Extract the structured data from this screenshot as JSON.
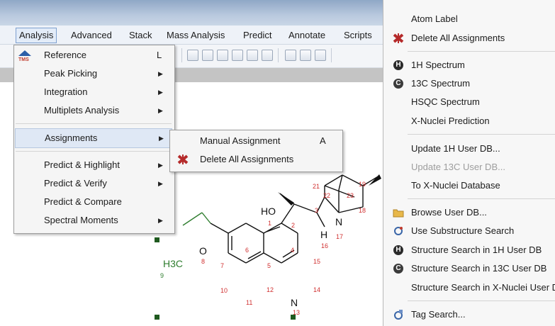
{
  "menubar": {
    "items": [
      "Analysis",
      "Advanced",
      "Stack",
      "Mass Analysis",
      "Predict",
      "Annotate",
      "Scripts"
    ]
  },
  "analysis_menu": {
    "items": [
      {
        "label": "Reference",
        "shortcut": "L",
        "icon": "tms-icon"
      },
      {
        "label": "Peak Picking",
        "submenu": true
      },
      {
        "label": "Integration",
        "submenu": true
      },
      {
        "label": "Multiplets Analysis",
        "submenu": true
      },
      {
        "label": "Assignments",
        "submenu": true,
        "highlighted": true
      },
      {
        "label": "Predict & Highlight",
        "submenu": true
      },
      {
        "label": "Predict & Verify",
        "submenu": true
      },
      {
        "label": "Predict & Compare"
      },
      {
        "label": "Spectral Moments",
        "submenu": true
      }
    ]
  },
  "assignments_submenu": {
    "items": [
      {
        "label": "Manual Assignment",
        "shortcut": "A"
      },
      {
        "label": "Delete All Assignments",
        "icon": "delete-assignments-icon"
      }
    ]
  },
  "context_menu": {
    "items": [
      {
        "label": "Atom Label"
      },
      {
        "label": "Delete All Assignments",
        "icon": "delete-assignments-icon"
      },
      {
        "label": "1H Spectrum",
        "icon": "h-icon"
      },
      {
        "label": "13C Spectrum",
        "icon": "c-icon"
      },
      {
        "label": "HSQC Spectrum"
      },
      {
        "label": "X-Nuclei Prediction"
      },
      {
        "label": "Update 1H User DB..."
      },
      {
        "label": "Update 13C User DB...",
        "disabled": true
      },
      {
        "label": "To X-Nuclei Database"
      },
      {
        "label": "Browse User DB...",
        "icon": "folder-icon"
      },
      {
        "label": "Use Substructure Search",
        "icon": "substructure-icon"
      },
      {
        "label": "Structure Search in 1H User DB",
        "icon": "h-icon"
      },
      {
        "label": "Structure Search in 13C User DB",
        "icon": "c-icon"
      },
      {
        "label": "Structure Search in X-Nuclei User DB"
      },
      {
        "label": "Tag Search...",
        "icon": "tag-icon"
      }
    ]
  },
  "molecule": {
    "atoms": [
      "HO",
      "H",
      "N",
      "N",
      "O",
      "H3C"
    ],
    "labels": [
      "1",
      "2",
      "3",
      "5",
      "6",
      "7",
      "8",
      "9",
      "10",
      "11",
      "12",
      "13",
      "14",
      "15",
      "16",
      "17",
      "18",
      "19",
      "21",
      "22",
      "23",
      "4"
    ]
  },
  "colors": {
    "menu_bg": "#f5f5f5",
    "highlight": "#dfe8f5",
    "atom_number": "#d03030",
    "methoxy": "#2e7d2e",
    "delete_icon": "#b52a2a"
  }
}
